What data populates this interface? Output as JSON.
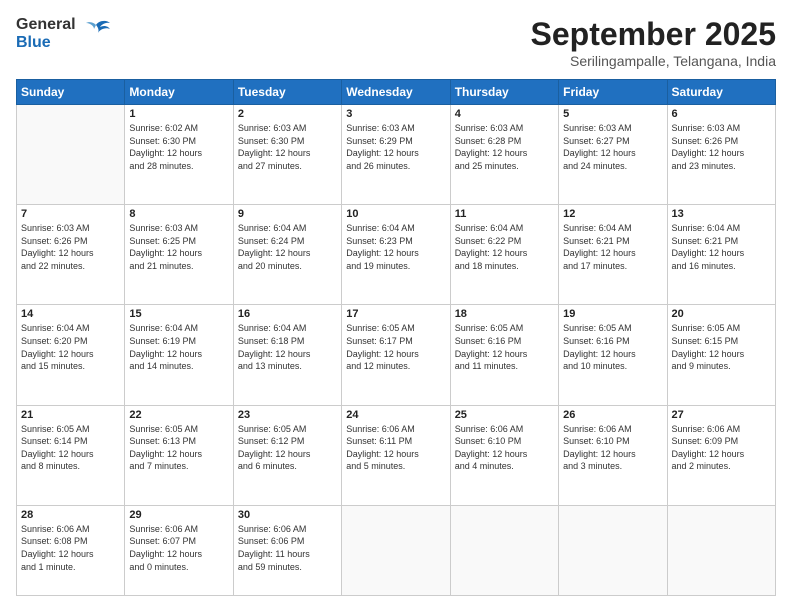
{
  "logo": {
    "line1": "General",
    "line2": "Blue"
  },
  "title": "September 2025",
  "location": "Serilingampalle, Telangana, India",
  "weekdays": [
    "Sunday",
    "Monday",
    "Tuesday",
    "Wednesday",
    "Thursday",
    "Friday",
    "Saturday"
  ],
  "weeks": [
    [
      {
        "day": "",
        "info": ""
      },
      {
        "day": "1",
        "info": "Sunrise: 6:02 AM\nSunset: 6:30 PM\nDaylight: 12 hours\nand 28 minutes."
      },
      {
        "day": "2",
        "info": "Sunrise: 6:03 AM\nSunset: 6:30 PM\nDaylight: 12 hours\nand 27 minutes."
      },
      {
        "day": "3",
        "info": "Sunrise: 6:03 AM\nSunset: 6:29 PM\nDaylight: 12 hours\nand 26 minutes."
      },
      {
        "day": "4",
        "info": "Sunrise: 6:03 AM\nSunset: 6:28 PM\nDaylight: 12 hours\nand 25 minutes."
      },
      {
        "day": "5",
        "info": "Sunrise: 6:03 AM\nSunset: 6:27 PM\nDaylight: 12 hours\nand 24 minutes."
      },
      {
        "day": "6",
        "info": "Sunrise: 6:03 AM\nSunset: 6:26 PM\nDaylight: 12 hours\nand 23 minutes."
      }
    ],
    [
      {
        "day": "7",
        "info": "Sunrise: 6:03 AM\nSunset: 6:26 PM\nDaylight: 12 hours\nand 22 minutes."
      },
      {
        "day": "8",
        "info": "Sunrise: 6:03 AM\nSunset: 6:25 PM\nDaylight: 12 hours\nand 21 minutes."
      },
      {
        "day": "9",
        "info": "Sunrise: 6:04 AM\nSunset: 6:24 PM\nDaylight: 12 hours\nand 20 minutes."
      },
      {
        "day": "10",
        "info": "Sunrise: 6:04 AM\nSunset: 6:23 PM\nDaylight: 12 hours\nand 19 minutes."
      },
      {
        "day": "11",
        "info": "Sunrise: 6:04 AM\nSunset: 6:22 PM\nDaylight: 12 hours\nand 18 minutes."
      },
      {
        "day": "12",
        "info": "Sunrise: 6:04 AM\nSunset: 6:21 PM\nDaylight: 12 hours\nand 17 minutes."
      },
      {
        "day": "13",
        "info": "Sunrise: 6:04 AM\nSunset: 6:21 PM\nDaylight: 12 hours\nand 16 minutes."
      }
    ],
    [
      {
        "day": "14",
        "info": "Sunrise: 6:04 AM\nSunset: 6:20 PM\nDaylight: 12 hours\nand 15 minutes."
      },
      {
        "day": "15",
        "info": "Sunrise: 6:04 AM\nSunset: 6:19 PM\nDaylight: 12 hours\nand 14 minutes."
      },
      {
        "day": "16",
        "info": "Sunrise: 6:04 AM\nSunset: 6:18 PM\nDaylight: 12 hours\nand 13 minutes."
      },
      {
        "day": "17",
        "info": "Sunrise: 6:05 AM\nSunset: 6:17 PM\nDaylight: 12 hours\nand 12 minutes."
      },
      {
        "day": "18",
        "info": "Sunrise: 6:05 AM\nSunset: 6:16 PM\nDaylight: 12 hours\nand 11 minutes."
      },
      {
        "day": "19",
        "info": "Sunrise: 6:05 AM\nSunset: 6:16 PM\nDaylight: 12 hours\nand 10 minutes."
      },
      {
        "day": "20",
        "info": "Sunrise: 6:05 AM\nSunset: 6:15 PM\nDaylight: 12 hours\nand 9 minutes."
      }
    ],
    [
      {
        "day": "21",
        "info": "Sunrise: 6:05 AM\nSunset: 6:14 PM\nDaylight: 12 hours\nand 8 minutes."
      },
      {
        "day": "22",
        "info": "Sunrise: 6:05 AM\nSunset: 6:13 PM\nDaylight: 12 hours\nand 7 minutes."
      },
      {
        "day": "23",
        "info": "Sunrise: 6:05 AM\nSunset: 6:12 PM\nDaylight: 12 hours\nand 6 minutes."
      },
      {
        "day": "24",
        "info": "Sunrise: 6:06 AM\nSunset: 6:11 PM\nDaylight: 12 hours\nand 5 minutes."
      },
      {
        "day": "25",
        "info": "Sunrise: 6:06 AM\nSunset: 6:10 PM\nDaylight: 12 hours\nand 4 minutes."
      },
      {
        "day": "26",
        "info": "Sunrise: 6:06 AM\nSunset: 6:10 PM\nDaylight: 12 hours\nand 3 minutes."
      },
      {
        "day": "27",
        "info": "Sunrise: 6:06 AM\nSunset: 6:09 PM\nDaylight: 12 hours\nand 2 minutes."
      }
    ],
    [
      {
        "day": "28",
        "info": "Sunrise: 6:06 AM\nSunset: 6:08 PM\nDaylight: 12 hours\nand 1 minute."
      },
      {
        "day": "29",
        "info": "Sunrise: 6:06 AM\nSunset: 6:07 PM\nDaylight: 12 hours\nand 0 minutes."
      },
      {
        "day": "30",
        "info": "Sunrise: 6:06 AM\nSunset: 6:06 PM\nDaylight: 11 hours\nand 59 minutes."
      },
      {
        "day": "",
        "info": ""
      },
      {
        "day": "",
        "info": ""
      },
      {
        "day": "",
        "info": ""
      },
      {
        "day": "",
        "info": ""
      }
    ]
  ]
}
